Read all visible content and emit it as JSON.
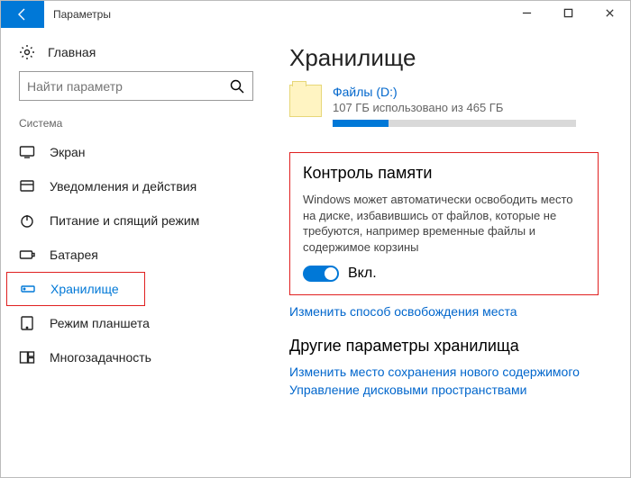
{
  "titlebar": {
    "title": "Параметры"
  },
  "sidebar": {
    "home": "Главная",
    "search_placeholder": "Найти параметр",
    "section": "Система",
    "items": [
      {
        "label": "Экран"
      },
      {
        "label": "Уведомления и действия"
      },
      {
        "label": "Питание и спящий режим"
      },
      {
        "label": "Батарея"
      },
      {
        "label": "Хранилище"
      },
      {
        "label": "Режим планшета"
      },
      {
        "label": "Многозадачность"
      }
    ]
  },
  "main": {
    "heading": "Хранилище",
    "drive": {
      "name": "Файлы (D:)",
      "usage_text": "107 ГБ использовано из 465 ГБ",
      "used_gb": 107,
      "total_gb": 465,
      "fill_percent": 23
    },
    "storage_sense": {
      "title": "Контроль памяти",
      "description": "Windows может автоматически освободить место на диске, избавившись от файлов, которые не требуются, например временные файлы и содержимое корзины",
      "toggle_label": "Вкл.",
      "toggle_on": true
    },
    "change_link": "Изменить способ освобождения места",
    "other_heading": "Другие параметры хранилища",
    "other_links": [
      "Изменить место сохранения нового содержимого",
      "Управление дисковыми пространствами"
    ]
  }
}
